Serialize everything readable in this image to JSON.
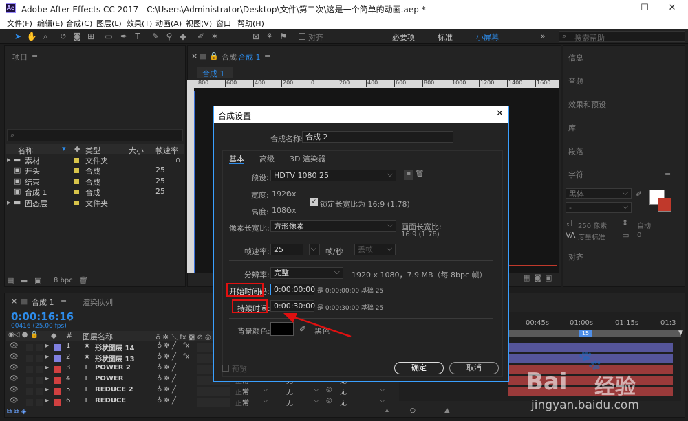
{
  "window": {
    "title": "Adobe After Effects CC 2017 - C:\\Users\\Administrator\\Desktop\\文件\\第二次\\这是一个简单的动画.aep *",
    "logo": "Ae",
    "min": "—",
    "max": "☐",
    "close": "✕"
  },
  "menu": [
    "文件(F)",
    "编辑(E)",
    "合成(C)",
    "图层(L)",
    "效果(T)",
    "动画(A)",
    "视图(V)",
    "窗口",
    "帮助(H)"
  ],
  "toolbar": {
    "align_label": "对齐",
    "workspaces": [
      "必要项",
      "标准",
      "小屏幕"
    ],
    "active_workspace": "小屏幕",
    "more": "»",
    "search_placeholder": "搜索帮助"
  },
  "project": {
    "tab": "项目",
    "menu_icon": "≡",
    "columns": [
      "名称",
      "类型",
      "大小",
      "帧速率"
    ],
    "rows": [
      {
        "name": "素材",
        "type": "文件夹",
        "rate": "",
        "folder": true
      },
      {
        "name": "开头",
        "type": "合成",
        "rate": "25",
        "folder": false
      },
      {
        "name": "结束",
        "type": "合成",
        "rate": "25",
        "folder": false
      },
      {
        "name": "合成 1",
        "type": "合成",
        "rate": "25",
        "folder": false
      },
      {
        "name": "固态层",
        "type": "文件夹",
        "rate": "",
        "folder": true
      }
    ],
    "bpc": "8 bpc"
  },
  "comp_panel": {
    "close": "×",
    "lock": "🔒",
    "tab_prefix": "合成",
    "tab_name": "合成 1",
    "menu_icon": "≡",
    "sub_tab": "合成 1",
    "ruler_marks": [
      "800",
      "600",
      "400",
      "200",
      "0",
      "200",
      "400",
      "600",
      "800",
      "1000",
      "1200",
      "1400",
      "1600"
    ]
  },
  "right_panels": [
    "信息",
    "音频",
    "效果和预设",
    "库",
    "段落",
    "字符",
    "对齐"
  ],
  "character": {
    "menu_icon": "≡",
    "font": "黑体",
    "style": "-",
    "size": "250 像素",
    "leading": "自动",
    "tracking": "度量标准",
    "kerning": "0"
  },
  "timeline": {
    "close": "×",
    "tab": "合成 1",
    "menu_icon": "≡",
    "render_tab": "渲染队列",
    "timecode": "0:00:16:16",
    "frames": "00416 (25.00 fps)",
    "search_icon": "⌕",
    "columns": [
      "图层名称"
    ],
    "ruler": [
      "00:45s",
      "01:00s",
      "01:15s",
      "01:3"
    ],
    "marker": "15",
    "layers": [
      {
        "num": "1",
        "type": "★",
        "name": "形状图层 14",
        "color": "#8080e0",
        "fx": "fx"
      },
      {
        "num": "2",
        "type": "★",
        "name": "形状图层 13",
        "color": "#8080e0",
        "fx": "fx"
      },
      {
        "num": "3",
        "type": "T",
        "name": "POWER 2",
        "color": "#d04040",
        "fx": ""
      },
      {
        "num": "4",
        "type": "T",
        "name": "POWER",
        "color": "#d04040",
        "fx": ""
      },
      {
        "num": "5",
        "type": "T",
        "name": "REDUCE 2",
        "color": "#d04040",
        "fx": ""
      },
      {
        "num": "6",
        "type": "T",
        "name": "REDUCE",
        "color": "#d04040",
        "fx": ""
      }
    ],
    "mode": "正常",
    "none": "无"
  },
  "dialog": {
    "title": "合成设置",
    "close": "✕",
    "name_label": "合成名称:",
    "name_value": "合成 2",
    "tabs": [
      "基本",
      "高级",
      "3D 渲染器"
    ],
    "preset_label": "预设:",
    "preset_value": "HDTV 1080 25",
    "preset_btn_save": "▪",
    "preset_btn_delete": "🗑",
    "width_label": "宽度:",
    "width_value": "1920",
    "height_label": "高度:",
    "height_value": "1080",
    "px": "px",
    "lock_label": "锁定长宽比为 16:9 (1.78)",
    "par_label": "像素长宽比:",
    "par_value": "方形像素",
    "frame_ar_label": "画面长宽比:",
    "frame_ar_value": "16:9 (1.78)",
    "fps_label": "帧速率:",
    "fps_value": "25",
    "fps_unit": "帧/秒",
    "drop_frame": "丢帧",
    "res_label": "分辨率:",
    "res_value": "完整",
    "res_info": "1920 x 1080，7.9 MB（每 8bpc 帧）",
    "start_label": "开始时间码:",
    "start_value": "0:00:00:00",
    "start_info": "是 0:00:00:00  基础 25",
    "dur_label": "持续时间:",
    "dur_value": "0:00:30:00",
    "dur_info": "是 0:00:30:00  基础 25",
    "bg_label": "背景颜色:",
    "bg_name": "黑色",
    "bg_color": "#000000",
    "preview": "预览",
    "ok": "确定",
    "cancel": "取消"
  },
  "watermark": {
    "brand": "Bai",
    "brand2": "经验",
    "url": "jingyan.baidu.com"
  },
  "colors": {
    "accent": "#2d8ceb",
    "annotation": "#e01010"
  }
}
